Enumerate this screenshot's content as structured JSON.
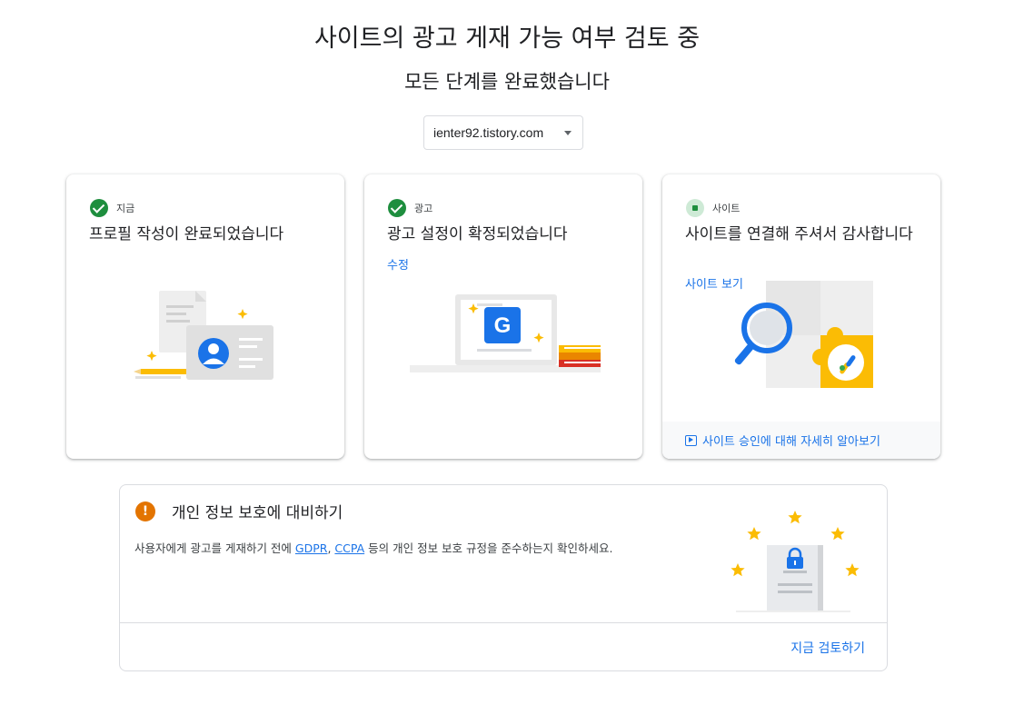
{
  "page": {
    "title": "사이트의 광고 게재 가능 여부 검토 중",
    "subtitle": "모든 단계를 완료했습니다"
  },
  "site_selector": {
    "value": "ienter92.tistory.com"
  },
  "cards": [
    {
      "tag": "지금",
      "status": "complete",
      "heading": "프로필 작성이 완료되었습니다"
    },
    {
      "tag": "광고",
      "status": "complete",
      "heading": "광고 설정이 확정되었습니다",
      "link": "수정"
    },
    {
      "tag": "사이트",
      "status": "pending",
      "heading": "사이트를 연결해 주셔서 감사합니다",
      "link": "사이트 보기",
      "footer_link": "사이트 승인에 대해 자세히 알아보기"
    }
  ],
  "privacy": {
    "title": "개인 정보 보호에 대비하기",
    "body_prefix": "사용자에게 광고를 게재하기 전에 ",
    "link_gdpr": "GDPR",
    "separator": ", ",
    "link_ccpa": "CCPA",
    "body_suffix": " 등의 개인 정보 보호 규정을 준수하는지 확인하세요.",
    "action": "지금 검토하기"
  },
  "colors": {
    "accent": "#1a73e8",
    "success": "#1e8e3e",
    "warning": "#e37400",
    "star": "#fbbc04"
  }
}
